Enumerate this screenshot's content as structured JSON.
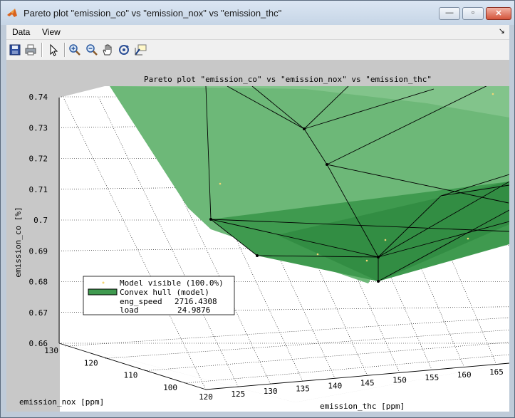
{
  "window": {
    "title": "Pareto plot \"emission_co\" vs \"emission_nox\" vs \"emission_thc\"",
    "buttons": {
      "minimize": "—",
      "maximize": "▫",
      "close": "✕"
    }
  },
  "menubar": {
    "items": [
      {
        "label": "Data"
      },
      {
        "label": "View"
      }
    ],
    "overflow_arrow": "↘"
  },
  "toolbar": {
    "icons": [
      "save-icon",
      "print-icon",
      "pointer-icon",
      "zoom-in-icon",
      "zoom-out-icon",
      "pan-hand-icon",
      "rotate-3d-icon",
      "data-cursor-icon"
    ]
  },
  "plot": {
    "title": "Pareto plot \"emission_co\" vs \"emission_nox\" vs \"emission_thc\"",
    "zlabel": "emission_co [%]",
    "ylabel": "emission_nox [ppm]",
    "xlabel": "emission_thc [ppm]",
    "legend": {
      "entries": [
        {
          "label": "Model visible (100.0%)"
        },
        {
          "label": "Convex hull (model)"
        }
      ],
      "info": [
        {
          "name": "eng_speed",
          "value": "2716.4308"
        },
        {
          "name": "load",
          "value": "24.9876"
        }
      ]
    }
  },
  "chart_data": {
    "type": "scatter",
    "title": "Pareto plot \"emission_co\" vs \"emission_nox\" vs \"emission_thc\"",
    "xlabel": "emission_thc [ppm]",
    "ylabel": "emission_nox [ppm]",
    "zlabel": "emission_co [%]",
    "x_ticks": [
      "120",
      "125",
      "130",
      "135",
      "140",
      "145",
      "150",
      "155",
      "160",
      "165"
    ],
    "y_ticks": [
      "100",
      "110",
      "120",
      "130"
    ],
    "z_ticks": [
      "0.66",
      "0.67",
      "0.68",
      "0.69",
      "0.7",
      "0.71",
      "0.72",
      "0.73",
      "0.74"
    ],
    "zlim": [
      0.66,
      0.74
    ],
    "grid": true,
    "legend_position": "lower-left",
    "surface_color": "#3f9a4f",
    "marker_color": "#f2d675"
  }
}
